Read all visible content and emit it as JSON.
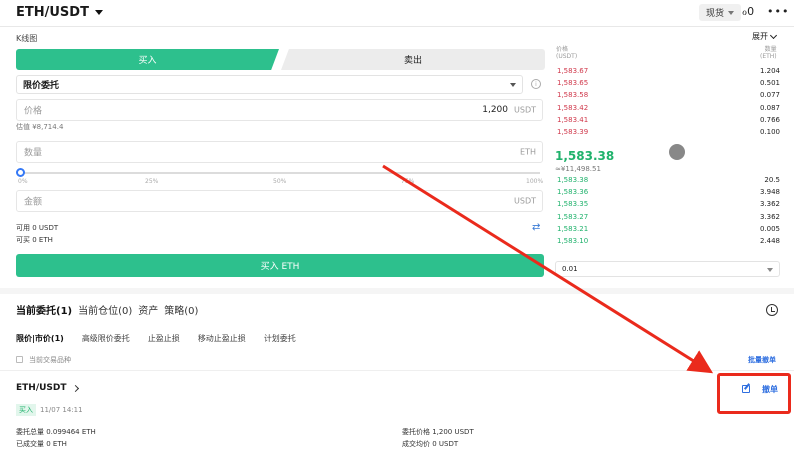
{
  "header": {
    "pair": "ETH/USDT",
    "market_chip": "现货",
    "icon_settings": "settings-icon",
    "icon_more": "more-icon"
  },
  "kline": {
    "label": "K线图",
    "expand_label": "展开"
  },
  "trade": {
    "buy_tab": "买入",
    "sell_tab": "卖出",
    "order_type": "限价委托",
    "price_label": "价格",
    "price_value": "1,200",
    "price_unit": "USDT",
    "estimate": "估值 ¥8,714.4",
    "amount_label": "数量",
    "amount_unit": "ETH",
    "slider_ticks": [
      "0%",
      "25%",
      "50%",
      "75%",
      "100%"
    ],
    "slider_value_pct": 0,
    "total_label": "金额",
    "total_unit": "USDT",
    "available": "可用 0 USDT",
    "can_buy": "可买 0 ETH",
    "buy_button": "买入 ETH"
  },
  "orderbook": {
    "price_header": [
      "价格",
      "(USDT)"
    ],
    "qty_header": [
      "数量",
      "(ETH)"
    ],
    "asks": [
      {
        "price": "1,583.67",
        "qty": "1.204"
      },
      {
        "price": "1,583.65",
        "qty": "0.501"
      },
      {
        "price": "1,583.58",
        "qty": "0.077"
      },
      {
        "price": "1,583.42",
        "qty": "0.087"
      },
      {
        "price": "1,583.41",
        "qty": "0.766"
      },
      {
        "price": "1,583.39",
        "qty": "0.100"
      }
    ],
    "last_price": "1,583.38",
    "last_price_cny": "≈¥11,498.51",
    "bids": [
      {
        "price": "1,583.38",
        "qty": "20.5"
      },
      {
        "price": "1,583.36",
        "qty": "3.948"
      },
      {
        "price": "1,583.35",
        "qty": "3.362"
      },
      {
        "price": "1,583.27",
        "qty": "3.362"
      },
      {
        "price": "1,583.21",
        "qty": "0.005"
      },
      {
        "price": "1,583.10",
        "qty": "2.448"
      }
    ],
    "depth": "0.01"
  },
  "orders": {
    "tabs": [
      "当前委托(1)",
      "当前仓位(0)",
      "资产",
      "策略(0)"
    ],
    "sub_tabs": [
      "限价|市价(1)",
      "高级限价委托",
      "止盈止损",
      "移动止盈止损",
      "计划委托"
    ],
    "current_pair_only": "当前交易品种",
    "batch_cancel": "批量撤单",
    "items": [
      {
        "pair": "ETH/USDT",
        "side": "买入",
        "time": "11/07 14:11",
        "total_label": "委托总量 0.099464 ETH",
        "filled_label": "已成交量 0 ETH",
        "price_label": "委托价格 1,200 USDT",
        "avg_label": "成交均价 0 USDT",
        "cancel": "撤单"
      }
    ]
  },
  "annotation": {
    "color": "#ea2a1c"
  }
}
